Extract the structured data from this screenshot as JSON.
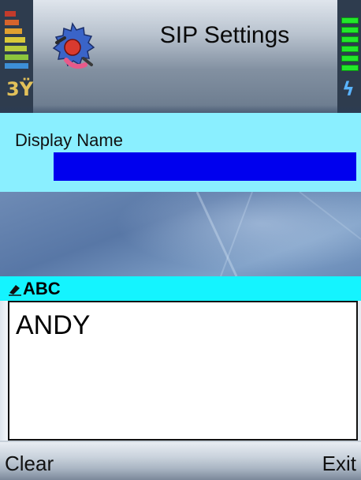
{
  "header": {
    "title": "SIP Settings",
    "app_icon": "tools-gear-icon",
    "signal_icon": "signal-strength-icon",
    "battery_icon": "battery-charging-icon"
  },
  "form": {
    "display_name_label": "Display Name",
    "display_name_value": ""
  },
  "input_mode": {
    "icon": "pen-icon",
    "label": "ABC"
  },
  "editor": {
    "text": "ANDY"
  },
  "softkeys": {
    "left": "Clear",
    "right": "Exit"
  },
  "colors": {
    "field_panel": "#8aefff",
    "field_input": "#0000ee",
    "mode_bar": "#14f4ff"
  }
}
